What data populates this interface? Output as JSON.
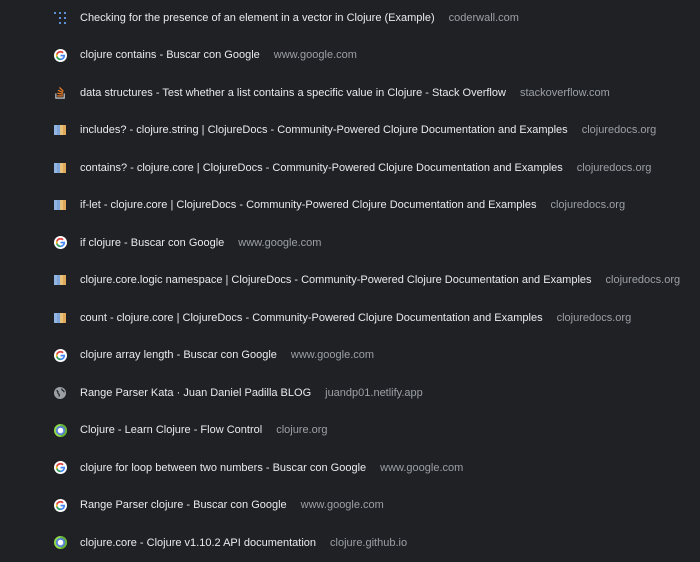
{
  "history": {
    "items": [
      {
        "title": "Checking for the presence of an element in a vector in Clojure (Example)",
        "domain": "coderwall.com",
        "icon": "coderwall-icon"
      },
      {
        "title": "clojure contains - Buscar con Google",
        "domain": "www.google.com",
        "icon": "google-icon"
      },
      {
        "title": "data structures - Test whether a list contains a specific value in Clojure - Stack Overflow",
        "domain": "stackoverflow.com",
        "icon": "stackoverflow-icon"
      },
      {
        "title": "includes? - clojure.string | ClojureDocs - Community-Powered Clojure Documentation and Examples",
        "domain": "clojuredocs.org",
        "icon": "clojuredocs-icon"
      },
      {
        "title": "contains? - clojure.core | ClojureDocs - Community-Powered Clojure Documentation and Examples",
        "domain": "clojuredocs.org",
        "icon": "clojuredocs-icon"
      },
      {
        "title": "if-let - clojure.core | ClojureDocs - Community-Powered Clojure Documentation and Examples",
        "domain": "clojuredocs.org",
        "icon": "clojuredocs-icon"
      },
      {
        "title": "if clojure - Buscar con Google",
        "domain": "www.google.com",
        "icon": "google-icon"
      },
      {
        "title": "clojure.core.logic namespace | ClojureDocs - Community-Powered Clojure Documentation and Examples",
        "domain": "clojuredocs.org",
        "icon": "clojuredocs-icon"
      },
      {
        "title": "count - clojure.core | ClojureDocs - Community-Powered Clojure Documentation and Examples",
        "domain": "clojuredocs.org",
        "icon": "clojuredocs-icon"
      },
      {
        "title": "clojure array length - Buscar con Google",
        "domain": "www.google.com",
        "icon": "google-icon"
      },
      {
        "title": "Range Parser Kata · Juan Daniel Padilla BLOG",
        "domain": "juandp01.netlify.app",
        "icon": "globe-icon"
      },
      {
        "title": "Clojure - Learn Clojure - Flow Control",
        "domain": "clojure.org",
        "icon": "clojure-icon"
      },
      {
        "title": "clojure for loop between two numbers - Buscar con Google",
        "domain": "www.google.com",
        "icon": "google-icon"
      },
      {
        "title": "Range Parser clojure - Buscar con Google",
        "domain": "www.google.com",
        "icon": "google-icon"
      },
      {
        "title": "clojure.core - Clojure v1.10.2 API documentation",
        "domain": "clojure.github.io",
        "icon": "clojure-icon"
      }
    ]
  },
  "colors": {
    "background": "#202124",
    "title": "#e8eaed",
    "domain": "#9aa0a6"
  }
}
